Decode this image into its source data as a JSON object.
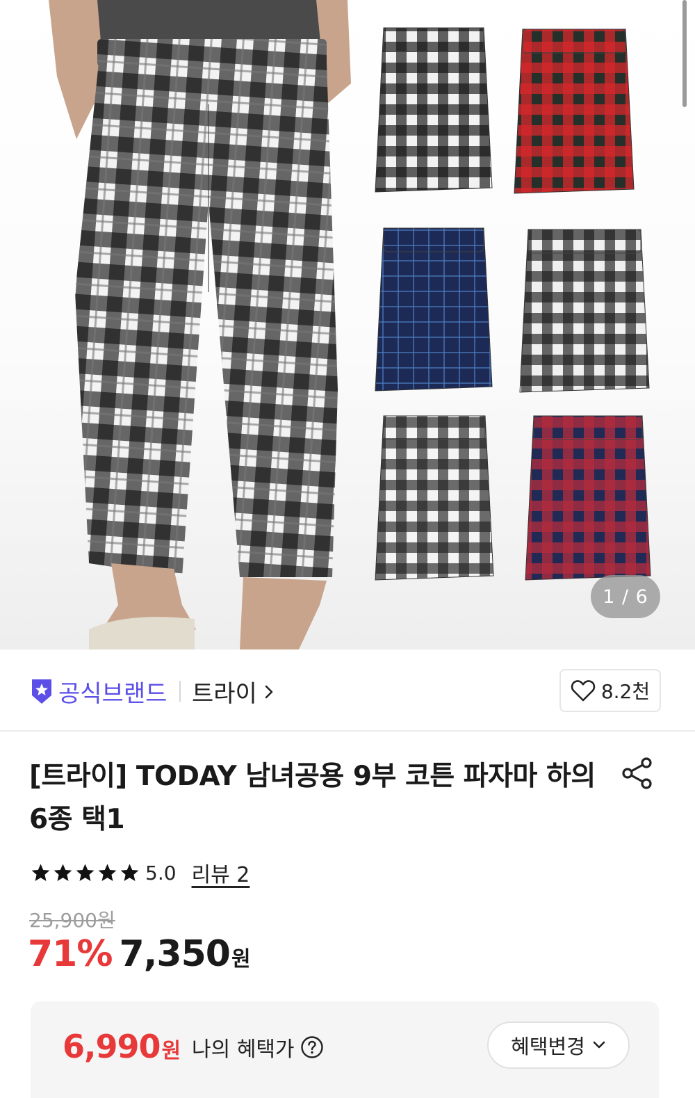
{
  "gallery": {
    "page_indicator": "1 / 6",
    "current_page": 1,
    "total_pages": 6,
    "variant_swatches": [
      {
        "name": "black-white-check",
        "base": "#f2f2f2",
        "line": "#111111"
      },
      {
        "name": "green-red-tartan",
        "base": "#25302a",
        "line": "#d6262b"
      },
      {
        "name": "navy-blue-check",
        "base": "#1d2a55",
        "line": "#4c7cc0"
      },
      {
        "name": "black-white-red-check",
        "base": "#f0f0f0",
        "line": "#1a1a1a"
      },
      {
        "name": "grey-white-check",
        "base": "#f4f4f4",
        "line": "#222222"
      },
      {
        "name": "navy-red-tartan",
        "base": "#212a55",
        "line": "#b42a3c"
      }
    ]
  },
  "brand": {
    "badge_label": "공식브랜드",
    "store_name": "트라이",
    "likes": "8.2천",
    "accent_color": "#5b4fe8"
  },
  "product": {
    "title": "[트라이] TODAY 남녀공용 9부 코튼 파자마 하의 6종 택1",
    "rating": 5,
    "rating_text": "5.0",
    "review_label": "리뷰 2",
    "original_price": "25,900원",
    "discount": "71%",
    "price": "7,350",
    "currency": "원",
    "sale_color": "#e8393a"
  },
  "benefit": {
    "price": "6,990",
    "currency": "원",
    "label": "나의 혜택가",
    "change_button": "혜택변경"
  }
}
